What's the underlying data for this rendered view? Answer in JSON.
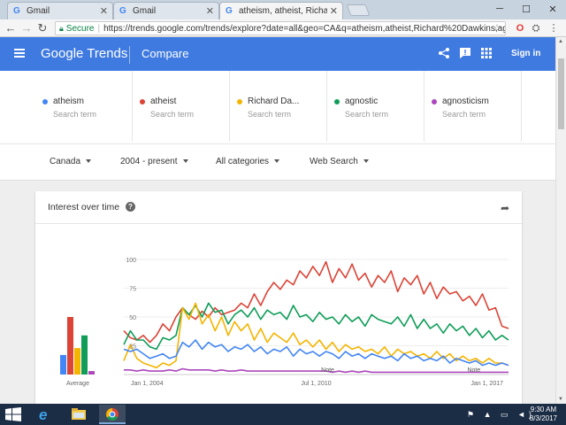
{
  "browser": {
    "tabs": [
      {
        "label": "Gmail",
        "favicon": "google-g-icon"
      },
      {
        "label": "Gmail",
        "favicon": "google-g-icon"
      },
      {
        "label": "atheism, atheist, Richard",
        "favicon": "google-g-icon"
      }
    ],
    "secure_label": "Secure",
    "url": "https://trends.google.com/trends/explore?date=all&geo=CA&q=atheism,atheist,Richard%20Dawkins,agnostic,ag..."
  },
  "header": {
    "logo": "Google Trends",
    "section": "Compare",
    "signin": "Sign in",
    "color": "#3f7ae0"
  },
  "terms": [
    {
      "name": "atheism",
      "sub": "Search term",
      "color": "#4285f4"
    },
    {
      "name": "atheist",
      "sub": "Search term",
      "color": "#db4437"
    },
    {
      "name": "Richard Da...",
      "sub": "Search term",
      "color": "#f4b400"
    },
    {
      "name": "agnostic",
      "sub": "Search term",
      "color": "#0f9d58"
    },
    {
      "name": "agnosticism",
      "sub": "Search term",
      "color": "#ab47bc"
    }
  ],
  "filters": {
    "region": "Canada",
    "time": "2004 - present",
    "category": "All categories",
    "search_type": "Web Search"
  },
  "card": {
    "title": "Interest over time"
  },
  "chart_data": {
    "type": "line",
    "y_ticks": [
      "100",
      "75",
      "50",
      "25"
    ],
    "ylim": [
      0,
      100
    ],
    "x_labels": [
      "Jan 1, 2004",
      "Jul 1, 2010",
      "Jan 1, 2017"
    ],
    "note_labels": [
      "Note",
      "Note"
    ],
    "average_label": "Average",
    "averages": [
      {
        "name": "atheism",
        "value": 17,
        "color": "#4285f4"
      },
      {
        "name": "atheist",
        "value": 50,
        "color": "#db4437"
      },
      {
        "name": "Richard Da...",
        "value": 23,
        "color": "#f4b400"
      },
      {
        "name": "agnostic",
        "value": 34,
        "color": "#0f9d58"
      },
      {
        "name": "agnosticism",
        "value": 3,
        "color": "#ab47bc"
      }
    ],
    "series": [
      {
        "name": "atheist",
        "color": "#db4437",
        "values": [
          38,
          32,
          30,
          34,
          28,
          34,
          44,
          38,
          50,
          58,
          52,
          48,
          55,
          50,
          58,
          52,
          54,
          56,
          62,
          58,
          70,
          60,
          72,
          80,
          74,
          82,
          78,
          90,
          84,
          94,
          86,
          98,
          80,
          92,
          84,
          96,
          82,
          88,
          76,
          86,
          80,
          90,
          72,
          84,
          78,
          86,
          70,
          80,
          66,
          76,
          70,
          72,
          64,
          68,
          60,
          70,
          56,
          58,
          42,
          40
        ]
      },
      {
        "name": "agnostic",
        "color": "#0f9d58",
        "values": [
          26,
          38,
          30,
          30,
          24,
          22,
          32,
          30,
          34,
          58,
          52,
          60,
          50,
          62,
          54,
          56,
          44,
          52,
          56,
          50,
          58,
          48,
          56,
          52,
          54,
          48,
          60,
          50,
          52,
          46,
          54,
          48,
          50,
          44,
          52,
          46,
          50,
          42,
          52,
          48,
          46,
          44,
          50,
          42,
          52,
          40,
          48,
          40,
          44,
          36,
          44,
          38,
          42,
          34,
          40,
          32,
          38,
          30,
          34,
          30
        ]
      },
      {
        "name": "Richard Da...",
        "color": "#f4b400",
        "values": [
          12,
          26,
          14,
          10,
          8,
          6,
          10,
          8,
          12,
          58,
          48,
          62,
          44,
          52,
          38,
          50,
          34,
          46,
          38,
          44,
          30,
          40,
          28,
          36,
          32,
          28,
          36,
          26,
          30,
          24,
          30,
          22,
          28,
          20,
          26,
          22,
          24,
          20,
          22,
          18,
          24,
          16,
          22,
          18,
          20,
          16,
          18,
          14,
          20,
          14,
          18,
          12,
          16,
          12,
          14,
          10,
          14,
          10,
          10,
          8
        ]
      },
      {
        "name": "atheism",
        "color": "#4285f4",
        "values": [
          22,
          20,
          22,
          18,
          14,
          16,
          18,
          14,
          16,
          28,
          24,
          30,
          22,
          28,
          24,
          26,
          20,
          24,
          22,
          26,
          20,
          24,
          18,
          22,
          20,
          24,
          16,
          22,
          18,
          20,
          16,
          20,
          18,
          14,
          20,
          16,
          18,
          14,
          18,
          16,
          14,
          16,
          12,
          18,
          14,
          16,
          12,
          14,
          12,
          16,
          10,
          14,
          12,
          10,
          12,
          8,
          10,
          8,
          10,
          8
        ]
      },
      {
        "name": "agnosticism",
        "color": "#ab47bc",
        "values": [
          4,
          4,
          3,
          4,
          3,
          3,
          3,
          4,
          3,
          5,
          4,
          4,
          4,
          4,
          3,
          4,
          3,
          3,
          4,
          3,
          3,
          3,
          3,
          3,
          3,
          3,
          3,
          3,
          3,
          3,
          3,
          3,
          2,
          3,
          2,
          3,
          2,
          3,
          2,
          2,
          2,
          2,
          2,
          2,
          2,
          2,
          2,
          2,
          2,
          2,
          2,
          2,
          2,
          2,
          2,
          2,
          2,
          2,
          2,
          2
        ]
      }
    ]
  },
  "taskbar": {
    "time": "9:30 AM",
    "date": "8/3/2017"
  }
}
